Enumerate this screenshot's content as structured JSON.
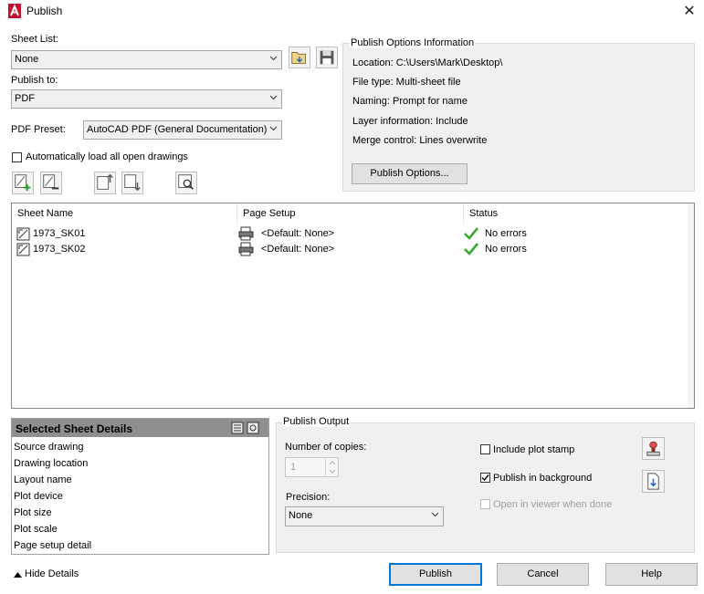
{
  "title": "Publish",
  "close_glyph": "✕",
  "sheet_list": {
    "label": "Sheet List:",
    "value": "None"
  },
  "publish_to": {
    "label": "Publish to:",
    "value": "PDF"
  },
  "pdf_preset": {
    "label": "PDF Preset:",
    "value": "AutoCAD PDF (General Documentation)"
  },
  "auto_load": {
    "label": "Automatically load all open drawings",
    "checked": false
  },
  "options_info": {
    "title": "Publish Options Information",
    "location": "Location: C:\\Users\\Mark\\Desktop\\",
    "file_type": "File type: Multi-sheet file",
    "naming": "Naming: Prompt for name",
    "layer_info": "Layer information: Include",
    "merge": "Merge control: Lines overwrite",
    "button": "Publish Options..."
  },
  "sheets": {
    "columns": [
      "Sheet Name",
      "Page Setup",
      "Status"
    ],
    "rows": [
      {
        "name": "1973_SK01",
        "setup": "<Default: None>",
        "status": "No errors"
      },
      {
        "name": "1973_SK02",
        "setup": "<Default: None>",
        "status": "No errors"
      }
    ]
  },
  "details": {
    "title": "Selected Sheet Details",
    "items": [
      "Source drawing",
      "Drawing location",
      "Layout name",
      "Plot device",
      "Plot size",
      "Plot scale",
      "Page setup detail"
    ]
  },
  "output": {
    "title": "Publish Output",
    "copies_label": "Number of copies:",
    "copies_value": "1",
    "precision_label": "Precision:",
    "precision_value": "None",
    "plot_stamp": "Include plot stamp",
    "background": "Publish in background",
    "open_viewer": "Open in viewer when done"
  },
  "buttons": {
    "hide_details": "Hide Details",
    "publish": "Publish",
    "cancel": "Cancel",
    "help": "Help"
  },
  "colors": {
    "accent": "#0078d7",
    "check": "#3aa832",
    "app_red": "#c8102e"
  }
}
